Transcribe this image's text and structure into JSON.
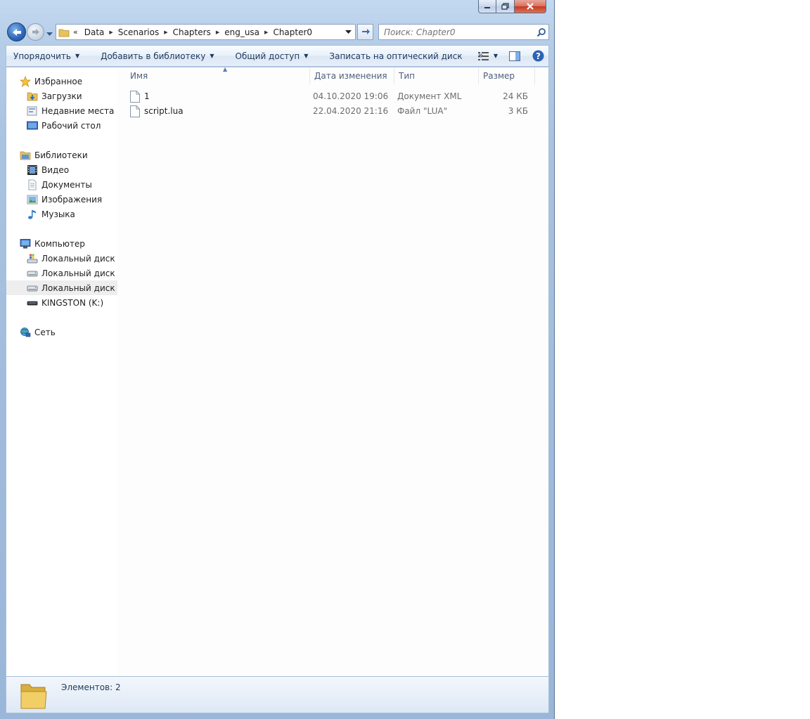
{
  "navigation": {
    "breadcrumb": {
      "overflow": "«",
      "items": [
        "Data",
        "Scenarios",
        "Chapters",
        "eng_usa",
        "Chapter0"
      ]
    },
    "search_placeholder": "Поиск: Chapter0"
  },
  "toolbar": {
    "organize": "Упорядочить",
    "add_to_library": "Добавить в библиотеку",
    "share": "Общий доступ",
    "burn": "Записать на оптический диск",
    "more": "»"
  },
  "sidebar": {
    "favorites": {
      "label": "Избранное",
      "items": [
        "Загрузки",
        "Недавние места",
        "Рабочий стол"
      ]
    },
    "libraries": {
      "label": "Библиотеки",
      "items": [
        "Видео",
        "Документы",
        "Изображения",
        "Музыка"
      ]
    },
    "computer": {
      "label": "Компьютер",
      "items": [
        "Локальный диск (C:)",
        "Локальный диск (D:)",
        "Локальный диск (E:)",
        "KINGSTON (K:)"
      ],
      "selected": "Локальный диск (E:)"
    },
    "network": {
      "label": "Сеть"
    }
  },
  "columns": {
    "name": "Имя",
    "date": "Дата изменения",
    "type": "Тип",
    "size": "Размер"
  },
  "files": [
    {
      "name": "1",
      "date": "04.10.2020 19:06",
      "type": "Документ XML",
      "size": "24 КБ"
    },
    {
      "name": "script.lua",
      "date": "22.04.2020 21:16",
      "type": "Файл \"LUA\"",
      "size": "3 КБ"
    }
  ],
  "status": {
    "items_count": "Элементов: 2"
  }
}
